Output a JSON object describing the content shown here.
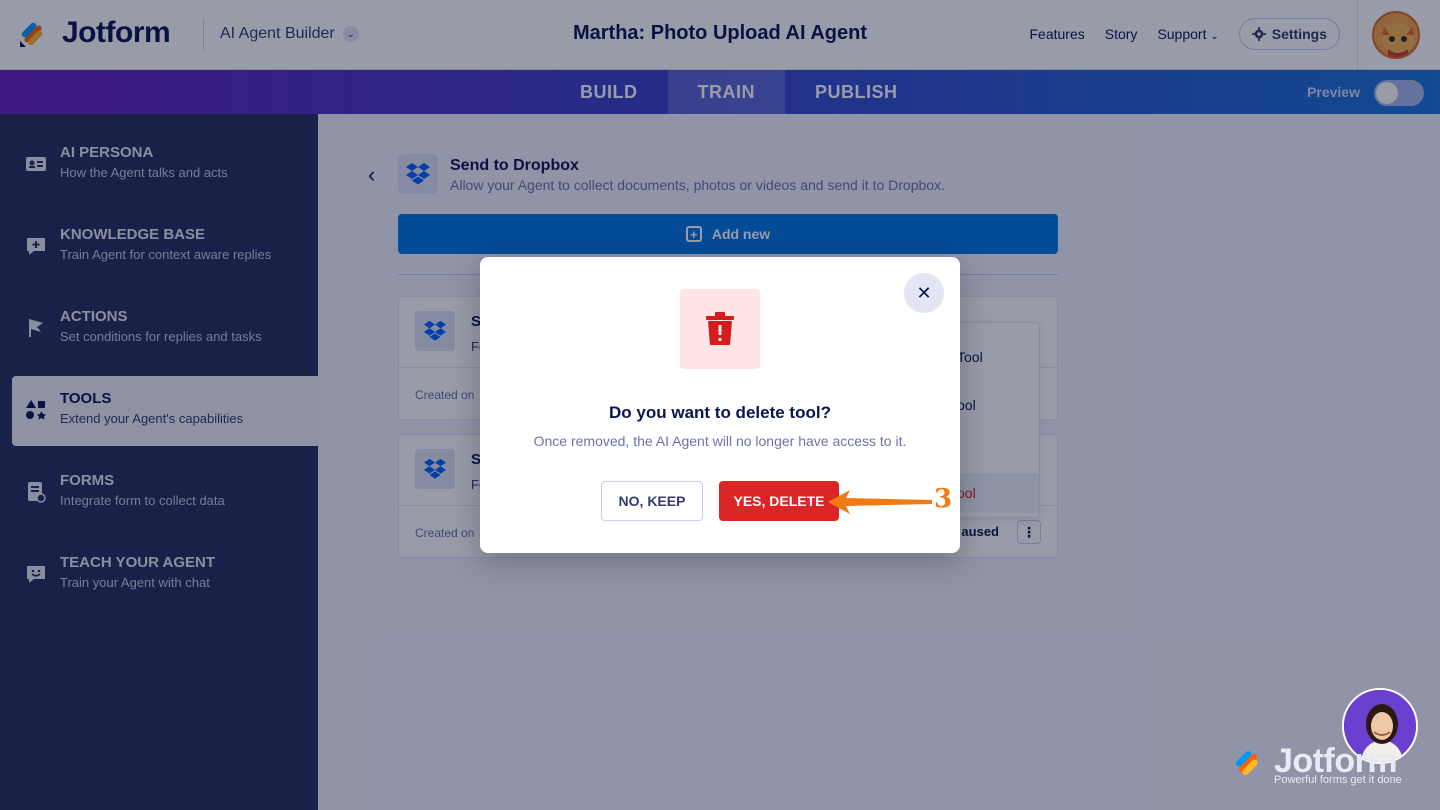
{
  "header": {
    "logo_text": "Jotform",
    "builder_label": "AI Agent Builder",
    "title": "Martha: Photo Upload AI Agent",
    "nav": [
      "Features",
      "Story",
      "Support"
    ],
    "settings_label": "Settings"
  },
  "tabbar": {
    "tabs": [
      {
        "label": "BUILD",
        "active": false
      },
      {
        "label": "TRAIN",
        "active": true
      },
      {
        "label": "PUBLISH",
        "active": false
      }
    ],
    "preview_label": "Preview"
  },
  "sidebar": {
    "items": [
      {
        "title": "AI PERSONA",
        "sub": "How the Agent talks and acts",
        "icon": "id-card-icon"
      },
      {
        "title": "KNOWLEDGE BASE",
        "sub": "Train Agent for context aware replies",
        "icon": "chat-plus-icon"
      },
      {
        "title": "ACTIONS",
        "sub": "Set conditions for replies and tasks",
        "icon": "flag-icon"
      },
      {
        "title": "TOOLS",
        "sub": "Extend your Agent's capabilities",
        "icon": "shapes-icon",
        "active": true
      },
      {
        "title": "FORMS",
        "sub": "Integrate form to collect data",
        "icon": "form-icon"
      },
      {
        "title": "TEACH YOUR AGENT",
        "sub": "Train your Agent with chat",
        "icon": "smile-chat-icon"
      }
    ]
  },
  "main": {
    "tool_title": "Send to Dropbox",
    "tool_sub": "Allow your Agent to collect documents, photos or videos and send it to Dropbox.",
    "add_new_label": "Add new",
    "cards": [
      {
        "name": "Se",
        "sub": "Fo",
        "created": "Created on"
      },
      {
        "name": "Se",
        "sub": "Fo",
        "created": "Created on",
        "status": "aused"
      }
    ],
    "menu_items": [
      "Tool",
      "ool",
      "ool"
    ]
  },
  "modal": {
    "title": "Do you want to delete tool?",
    "subtitle": "Once removed, the AI Agent will no longer have access to it.",
    "keep_label": "NO, KEEP",
    "delete_label": "YES, DELETE",
    "close_glyph": "✕"
  },
  "annotation": {
    "step": "3",
    "color": "#f07a14"
  },
  "branding": {
    "name": "Jotform",
    "tagline": "Powerful forms get it done"
  },
  "colors": {
    "primary": "#0075e3",
    "danger": "#dc2626",
    "navy": "#0a1551",
    "sidebar": "#252d5b"
  }
}
